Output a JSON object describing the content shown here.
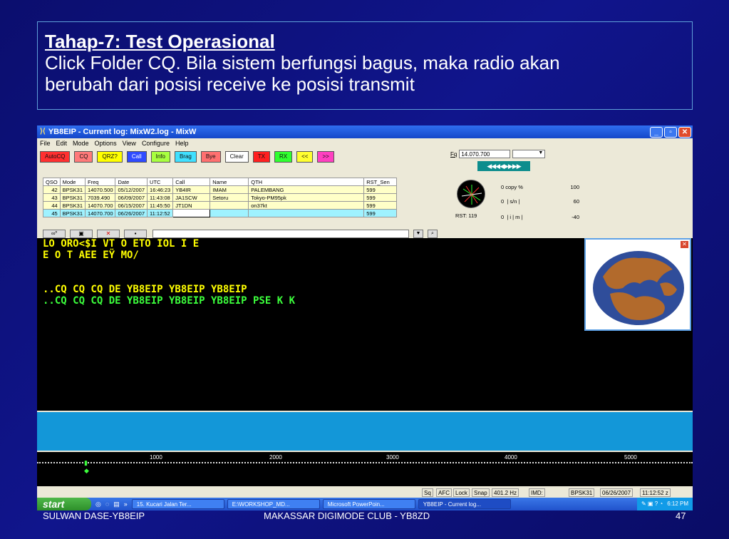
{
  "slide": {
    "heading": "Tahap-7: Test Operasional",
    "line1": "Click Folder CQ. Bila sistem berfungsi bagus, maka radio akan",
    "line2": "berubah dari posisi receive ke posisi transmit",
    "footer_left": "SULWAN DASE-YB8EIP",
    "footer_center": "MAKASSAR DIGIMODE CLUB - YB8ZD",
    "page_number": "47"
  },
  "window": {
    "title": "YB8EIP - Current log: MixW2.log - MixW",
    "menu": [
      "File",
      "Edit",
      "Mode",
      "Options",
      "View",
      "Configure",
      "Help"
    ]
  },
  "toolbar": {
    "buttons": [
      {
        "label": "AutoCQ",
        "color": "#ff3030"
      },
      {
        "label": "CQ",
        "color": "#ff7a7a"
      },
      {
        "label": "QRZ?",
        "color": "#ffff00"
      },
      {
        "label": "Call",
        "color": "#2f4bff"
      },
      {
        "label": "Info",
        "color": "#a8ff40"
      },
      {
        "label": "Brag",
        "color": "#40e0ff"
      },
      {
        "label": "Bye",
        "color": "#ff7070"
      },
      {
        "label": "Clear",
        "color": "#ffffff"
      },
      {
        "label": "TX",
        "color": "#ff2020"
      },
      {
        "label": "RX",
        "color": "#30ff30"
      },
      {
        "label": "<<",
        "color": "#ffff30"
      },
      {
        "label": ">>",
        "color": "#ff40c0"
      }
    ]
  },
  "frequency": {
    "label": "Fq",
    "value": "14.070.700",
    "arrows": "◀◀◀◀▶▶▶▶"
  },
  "log": {
    "headers": [
      "QSO",
      "Mode",
      "Freq",
      "Date",
      "UTC",
      "Call",
      "Name",
      "QTH",
      "RST_Sen"
    ],
    "rows": [
      [
        "42",
        "BPSK31",
        "14070.500",
        "05/12/2007",
        "16:46:23",
        "YB4IR",
        "IMAM",
        "PALEMBANG",
        "599"
      ],
      [
        "43",
        "BPSK31",
        "7039.490",
        "06/09/2007",
        "11:43:08",
        "JA1SCW",
        "Setoru",
        "Tokyo-PM95pk",
        "599"
      ],
      [
        "44",
        "BPSK31",
        "14070.700",
        "06/15/2007",
        "11:45:50",
        "JT1DN",
        "",
        "on37kt",
        "599"
      ],
      [
        "45",
        "BPSK31",
        "14070.700",
        "06/26/2007",
        "11:12:52",
        "",
        "",
        "",
        "599"
      ]
    ]
  },
  "meters": {
    "copy_label": "copy %",
    "copy_value": "100",
    "sn_label": "s/n",
    "sn_value": "60",
    "imd_label": "m",
    "imd_value": "-40",
    "rst": "RST: 119"
  },
  "rx_text": {
    "line1": "LO ORO<$I VT O  ETO IOL  I E",
    "line2": "E O  T AEE EŸ MO/",
    "line3": "..CQ CQ CQ  DE YB8EIP  YB8EIP  YB8EIP",
    "line4": "..CQ CQ CQ  DE YB8EIP  YB8EIP  YB8EIP PSE K K"
  },
  "waterfall": {
    "ticks": [
      "1000",
      "2000",
      "3000",
      "4000",
      "5000"
    ]
  },
  "status": {
    "items": [
      "Sq",
      "AFC",
      "Lock",
      "Snap",
      "401.2 Hz",
      "IMD:",
      "BPSK31",
      "06/26/2007",
      "11:12:52 z"
    ]
  },
  "taskbar": {
    "start": "start",
    "tasks": [
      "15. Kucari Jalan Ter...",
      "E:\\WORKSHOP_MD...",
      "Microsoft PowerPoin...",
      "YB8EIP - Current log..."
    ],
    "time": "6:12 PM"
  }
}
